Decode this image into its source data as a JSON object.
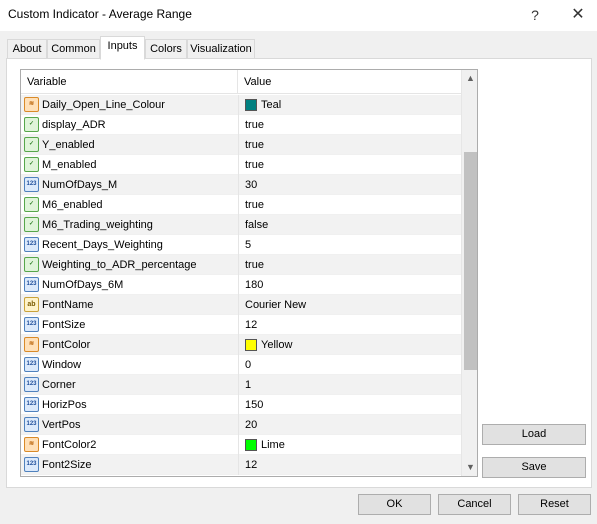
{
  "window": {
    "title": "Custom Indicator - Average Range",
    "help_glyph": "?",
    "close_glyph": "✕"
  },
  "tabs": [
    {
      "label": "About"
    },
    {
      "label": "Common"
    },
    {
      "label": "Inputs",
      "active": true
    },
    {
      "label": "Colors"
    },
    {
      "label": "Visualization"
    }
  ],
  "grid": {
    "headers": {
      "variable": "Variable",
      "value": "Value"
    },
    "rows": [
      {
        "type": "color",
        "variable": "Daily_Open_Line_Colour",
        "value": "Teal",
        "color": "#008080"
      },
      {
        "type": "bool",
        "variable": "display_ADR",
        "value": "true"
      },
      {
        "type": "bool",
        "variable": "Y_enabled",
        "value": "true"
      },
      {
        "type": "bool",
        "variable": "M_enabled",
        "value": "true"
      },
      {
        "type": "int",
        "variable": "NumOfDays_M",
        "value": "30"
      },
      {
        "type": "bool",
        "variable": "M6_enabled",
        "value": "true"
      },
      {
        "type": "bool",
        "variable": "M6_Trading_weighting",
        "value": "false"
      },
      {
        "type": "int",
        "variable": "Recent_Days_Weighting",
        "value": "5"
      },
      {
        "type": "bool",
        "variable": "Weighting_to_ADR_percentage",
        "value": "true"
      },
      {
        "type": "int",
        "variable": "NumOfDays_6M",
        "value": "180"
      },
      {
        "type": "string",
        "variable": "FontName",
        "value": "Courier New"
      },
      {
        "type": "int",
        "variable": "FontSize",
        "value": "12"
      },
      {
        "type": "color",
        "variable": "FontColor",
        "value": "Yellow",
        "color": "#ffff00"
      },
      {
        "type": "int",
        "variable": "Window",
        "value": "0"
      },
      {
        "type": "int",
        "variable": "Corner",
        "value": "1"
      },
      {
        "type": "int",
        "variable": "HorizPos",
        "value": "150"
      },
      {
        "type": "int",
        "variable": "VertPos",
        "value": "20"
      },
      {
        "type": "color",
        "variable": "FontColor2",
        "value": "Lime",
        "color": "#00ff00"
      },
      {
        "type": "int",
        "variable": "Font2Size",
        "value": "12"
      }
    ],
    "scroll_position": 0.42
  },
  "icons": {
    "int": "123",
    "bool": "✓",
    "string": "ab",
    "color": "≋"
  },
  "side_buttons": {
    "load": "Load",
    "save": "Save"
  },
  "footer_buttons": {
    "ok": "OK",
    "cancel": "Cancel",
    "reset": "Reset"
  }
}
